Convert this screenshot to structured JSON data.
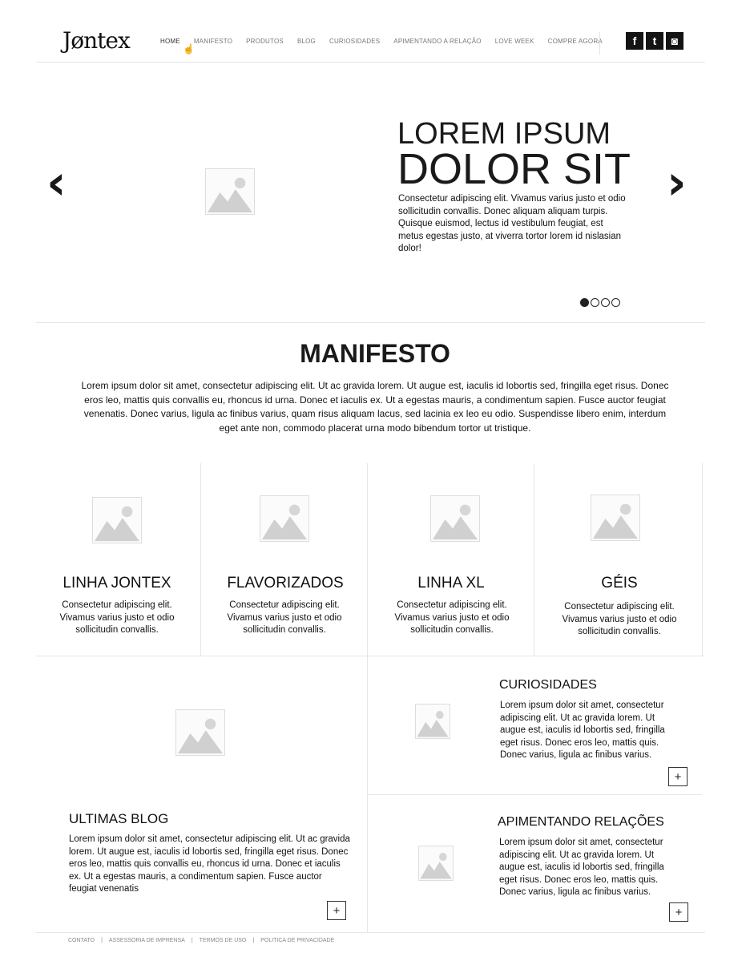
{
  "header": {
    "logo": "Jøntex",
    "nav": [
      "HOME",
      "MANIFESTO",
      "PRODUTOS",
      "BLOG",
      "CURIOSIDADES",
      "APIMENTANDO A RELAÇÃO",
      "LOVE WEEK",
      "COMPRE AGORA"
    ],
    "social": [
      {
        "icon": "facebook-icon",
        "glyph": "f"
      },
      {
        "icon": "twitter-icon",
        "glyph": "t"
      },
      {
        "icon": "instagram-icon",
        "glyph": "◙"
      }
    ]
  },
  "hero": {
    "title_line1": "LOREM IPSUM",
    "title_line2": "DOLOR SIT",
    "text": "Consectetur adipiscing elit. Vivamus varius justo et odio sollicitudin convallis. Donec aliquam aliquam turpis. Quisque euismod, lectus id vestibulum feugiat, est metus egestas justo, at viverra tortor lorem id nislasian dolor!",
    "prev_glyph": "‹",
    "next_glyph": "›",
    "slide_count": 4,
    "active_slide": 1
  },
  "manifesto": {
    "title": "MANIFESTO",
    "text": "Lorem ipsum dolor sit amet, consectetur adipiscing elit. Ut ac gravida lorem. Ut augue est, iaculis id lobortis sed, fringilla eget risus. Donec eros leo, mattis quis convallis eu, rhoncus id urna. Donec et iaculis ex. Ut a egestas mauris, a condimentum sapien. Fusce auctor feugiat venenatis. Donec varius, ligula ac finibus varius, quam risus aliquam lacus, sed lacinia ex leo eu odio. Suspendisse libero enim, interdum eget ante non, commodo placerat urna modo bibendum tortor ut tristique."
  },
  "products": [
    {
      "title": "LINHA JONTEX",
      "text": "Consectetur adipiscing elit. Vivamus varius justo et odio sollicitudin convallis."
    },
    {
      "title": "FLAVORIZADOS",
      "text": "Consectetur adipiscing elit. Vivamus varius justo et odio sollicitudin convallis."
    },
    {
      "title": "LINHA XL",
      "text": "Consectetur adipiscing elit. Vivamus varius justo et odio sollicitudin convallis."
    },
    {
      "title": "GÉIS",
      "text": "Consectetur adipiscing elit. Vivamus varius justo et odio sollicitudin convallis."
    }
  ],
  "blog": {
    "title": "ULTIMAS BLOG",
    "text": "Lorem ipsum dolor sit amet, consectetur adipiscing elit. Ut ac gravida lorem. Ut augue est, iaculis id lobortis sed, fringilla eget risus. Donec eros leo, mattis quis convallis eu, rhoncus id urna. Donec et iaculis ex. Ut a egestas mauris, a condimentum sapien. Fusce auctor feugiat venenatis",
    "more": "+"
  },
  "curiosidades": {
    "title": "CURIOSIDADES",
    "text": "Lorem ipsum dolor sit amet, consectetur adipiscing elit. Ut ac gravida lorem. Ut augue est, iaculis id lobortis sed, fringilla eget risus. Donec eros leo, mattis quis. Donec varius, ligula ac finibus varius.",
    "more": "+"
  },
  "apimentando": {
    "title": "APIMENTANDO RELAÇÕES",
    "text": "Lorem ipsum dolor sit amet, consectetur adipiscing elit. Ut ac gravida lorem. Ut augue est, iaculis id lobortis sed, fringilla eget risus. Donec eros leo, mattis quis. Donec varius, ligula ac finibus varius.",
    "more": "+"
  },
  "footer": {
    "links": [
      "CONTATO",
      "ASSESSORIA DE IMPRENSA",
      "TERMOS DE USO",
      "POLITICA DE PRIVACIDADE"
    ],
    "separator": "|"
  }
}
